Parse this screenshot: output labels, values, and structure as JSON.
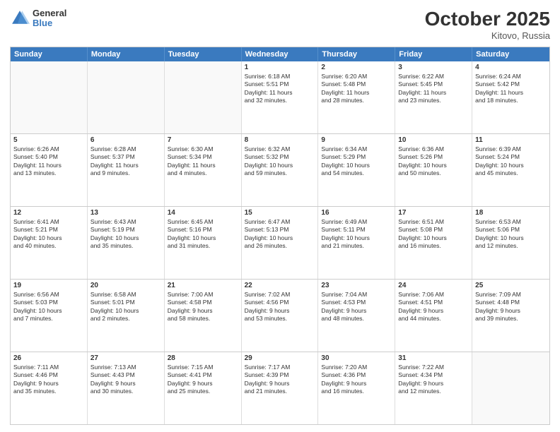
{
  "logo": {
    "general": "General",
    "blue": "Blue"
  },
  "header": {
    "month": "October 2025",
    "location": "Kitovo, Russia"
  },
  "weekdays": [
    "Sunday",
    "Monday",
    "Tuesday",
    "Wednesday",
    "Thursday",
    "Friday",
    "Saturday"
  ],
  "rows": [
    [
      {
        "day": "",
        "lines": [],
        "empty": true
      },
      {
        "day": "",
        "lines": [],
        "empty": true
      },
      {
        "day": "",
        "lines": [],
        "empty": true
      },
      {
        "day": "1",
        "lines": [
          "Sunrise: 6:18 AM",
          "Sunset: 5:51 PM",
          "Daylight: 11 hours",
          "and 32 minutes."
        ],
        "empty": false
      },
      {
        "day": "2",
        "lines": [
          "Sunrise: 6:20 AM",
          "Sunset: 5:48 PM",
          "Daylight: 11 hours",
          "and 28 minutes."
        ],
        "empty": false
      },
      {
        "day": "3",
        "lines": [
          "Sunrise: 6:22 AM",
          "Sunset: 5:45 PM",
          "Daylight: 11 hours",
          "and 23 minutes."
        ],
        "empty": false
      },
      {
        "day": "4",
        "lines": [
          "Sunrise: 6:24 AM",
          "Sunset: 5:42 PM",
          "Daylight: 11 hours",
          "and 18 minutes."
        ],
        "empty": false
      }
    ],
    [
      {
        "day": "5",
        "lines": [
          "Sunrise: 6:26 AM",
          "Sunset: 5:40 PM",
          "Daylight: 11 hours",
          "and 13 minutes."
        ],
        "empty": false
      },
      {
        "day": "6",
        "lines": [
          "Sunrise: 6:28 AM",
          "Sunset: 5:37 PM",
          "Daylight: 11 hours",
          "and 9 minutes."
        ],
        "empty": false
      },
      {
        "day": "7",
        "lines": [
          "Sunrise: 6:30 AM",
          "Sunset: 5:34 PM",
          "Daylight: 11 hours",
          "and 4 minutes."
        ],
        "empty": false
      },
      {
        "day": "8",
        "lines": [
          "Sunrise: 6:32 AM",
          "Sunset: 5:32 PM",
          "Daylight: 10 hours",
          "and 59 minutes."
        ],
        "empty": false
      },
      {
        "day": "9",
        "lines": [
          "Sunrise: 6:34 AM",
          "Sunset: 5:29 PM",
          "Daylight: 10 hours",
          "and 54 minutes."
        ],
        "empty": false
      },
      {
        "day": "10",
        "lines": [
          "Sunrise: 6:36 AM",
          "Sunset: 5:26 PM",
          "Daylight: 10 hours",
          "and 50 minutes."
        ],
        "empty": false
      },
      {
        "day": "11",
        "lines": [
          "Sunrise: 6:39 AM",
          "Sunset: 5:24 PM",
          "Daylight: 10 hours",
          "and 45 minutes."
        ],
        "empty": false
      }
    ],
    [
      {
        "day": "12",
        "lines": [
          "Sunrise: 6:41 AM",
          "Sunset: 5:21 PM",
          "Daylight: 10 hours",
          "and 40 minutes."
        ],
        "empty": false
      },
      {
        "day": "13",
        "lines": [
          "Sunrise: 6:43 AM",
          "Sunset: 5:19 PM",
          "Daylight: 10 hours",
          "and 35 minutes."
        ],
        "empty": false
      },
      {
        "day": "14",
        "lines": [
          "Sunrise: 6:45 AM",
          "Sunset: 5:16 PM",
          "Daylight: 10 hours",
          "and 31 minutes."
        ],
        "empty": false
      },
      {
        "day": "15",
        "lines": [
          "Sunrise: 6:47 AM",
          "Sunset: 5:13 PM",
          "Daylight: 10 hours",
          "and 26 minutes."
        ],
        "empty": false
      },
      {
        "day": "16",
        "lines": [
          "Sunrise: 6:49 AM",
          "Sunset: 5:11 PM",
          "Daylight: 10 hours",
          "and 21 minutes."
        ],
        "empty": false
      },
      {
        "day": "17",
        "lines": [
          "Sunrise: 6:51 AM",
          "Sunset: 5:08 PM",
          "Daylight: 10 hours",
          "and 16 minutes."
        ],
        "empty": false
      },
      {
        "day": "18",
        "lines": [
          "Sunrise: 6:53 AM",
          "Sunset: 5:06 PM",
          "Daylight: 10 hours",
          "and 12 minutes."
        ],
        "empty": false
      }
    ],
    [
      {
        "day": "19",
        "lines": [
          "Sunrise: 6:56 AM",
          "Sunset: 5:03 PM",
          "Daylight: 10 hours",
          "and 7 minutes."
        ],
        "empty": false
      },
      {
        "day": "20",
        "lines": [
          "Sunrise: 6:58 AM",
          "Sunset: 5:01 PM",
          "Daylight: 10 hours",
          "and 2 minutes."
        ],
        "empty": false
      },
      {
        "day": "21",
        "lines": [
          "Sunrise: 7:00 AM",
          "Sunset: 4:58 PM",
          "Daylight: 9 hours",
          "and 58 minutes."
        ],
        "empty": false
      },
      {
        "day": "22",
        "lines": [
          "Sunrise: 7:02 AM",
          "Sunset: 4:56 PM",
          "Daylight: 9 hours",
          "and 53 minutes."
        ],
        "empty": false
      },
      {
        "day": "23",
        "lines": [
          "Sunrise: 7:04 AM",
          "Sunset: 4:53 PM",
          "Daylight: 9 hours",
          "and 48 minutes."
        ],
        "empty": false
      },
      {
        "day": "24",
        "lines": [
          "Sunrise: 7:06 AM",
          "Sunset: 4:51 PM",
          "Daylight: 9 hours",
          "and 44 minutes."
        ],
        "empty": false
      },
      {
        "day": "25",
        "lines": [
          "Sunrise: 7:09 AM",
          "Sunset: 4:48 PM",
          "Daylight: 9 hours",
          "and 39 minutes."
        ],
        "empty": false
      }
    ],
    [
      {
        "day": "26",
        "lines": [
          "Sunrise: 7:11 AM",
          "Sunset: 4:46 PM",
          "Daylight: 9 hours",
          "and 35 minutes."
        ],
        "empty": false
      },
      {
        "day": "27",
        "lines": [
          "Sunrise: 7:13 AM",
          "Sunset: 4:43 PM",
          "Daylight: 9 hours",
          "and 30 minutes."
        ],
        "empty": false
      },
      {
        "day": "28",
        "lines": [
          "Sunrise: 7:15 AM",
          "Sunset: 4:41 PM",
          "Daylight: 9 hours",
          "and 25 minutes."
        ],
        "empty": false
      },
      {
        "day": "29",
        "lines": [
          "Sunrise: 7:17 AM",
          "Sunset: 4:39 PM",
          "Daylight: 9 hours",
          "and 21 minutes."
        ],
        "empty": false
      },
      {
        "day": "30",
        "lines": [
          "Sunrise: 7:20 AM",
          "Sunset: 4:36 PM",
          "Daylight: 9 hours",
          "and 16 minutes."
        ],
        "empty": false
      },
      {
        "day": "31",
        "lines": [
          "Sunrise: 7:22 AM",
          "Sunset: 4:34 PM",
          "Daylight: 9 hours",
          "and 12 minutes."
        ],
        "empty": false
      },
      {
        "day": "",
        "lines": [],
        "empty": true
      }
    ]
  ]
}
